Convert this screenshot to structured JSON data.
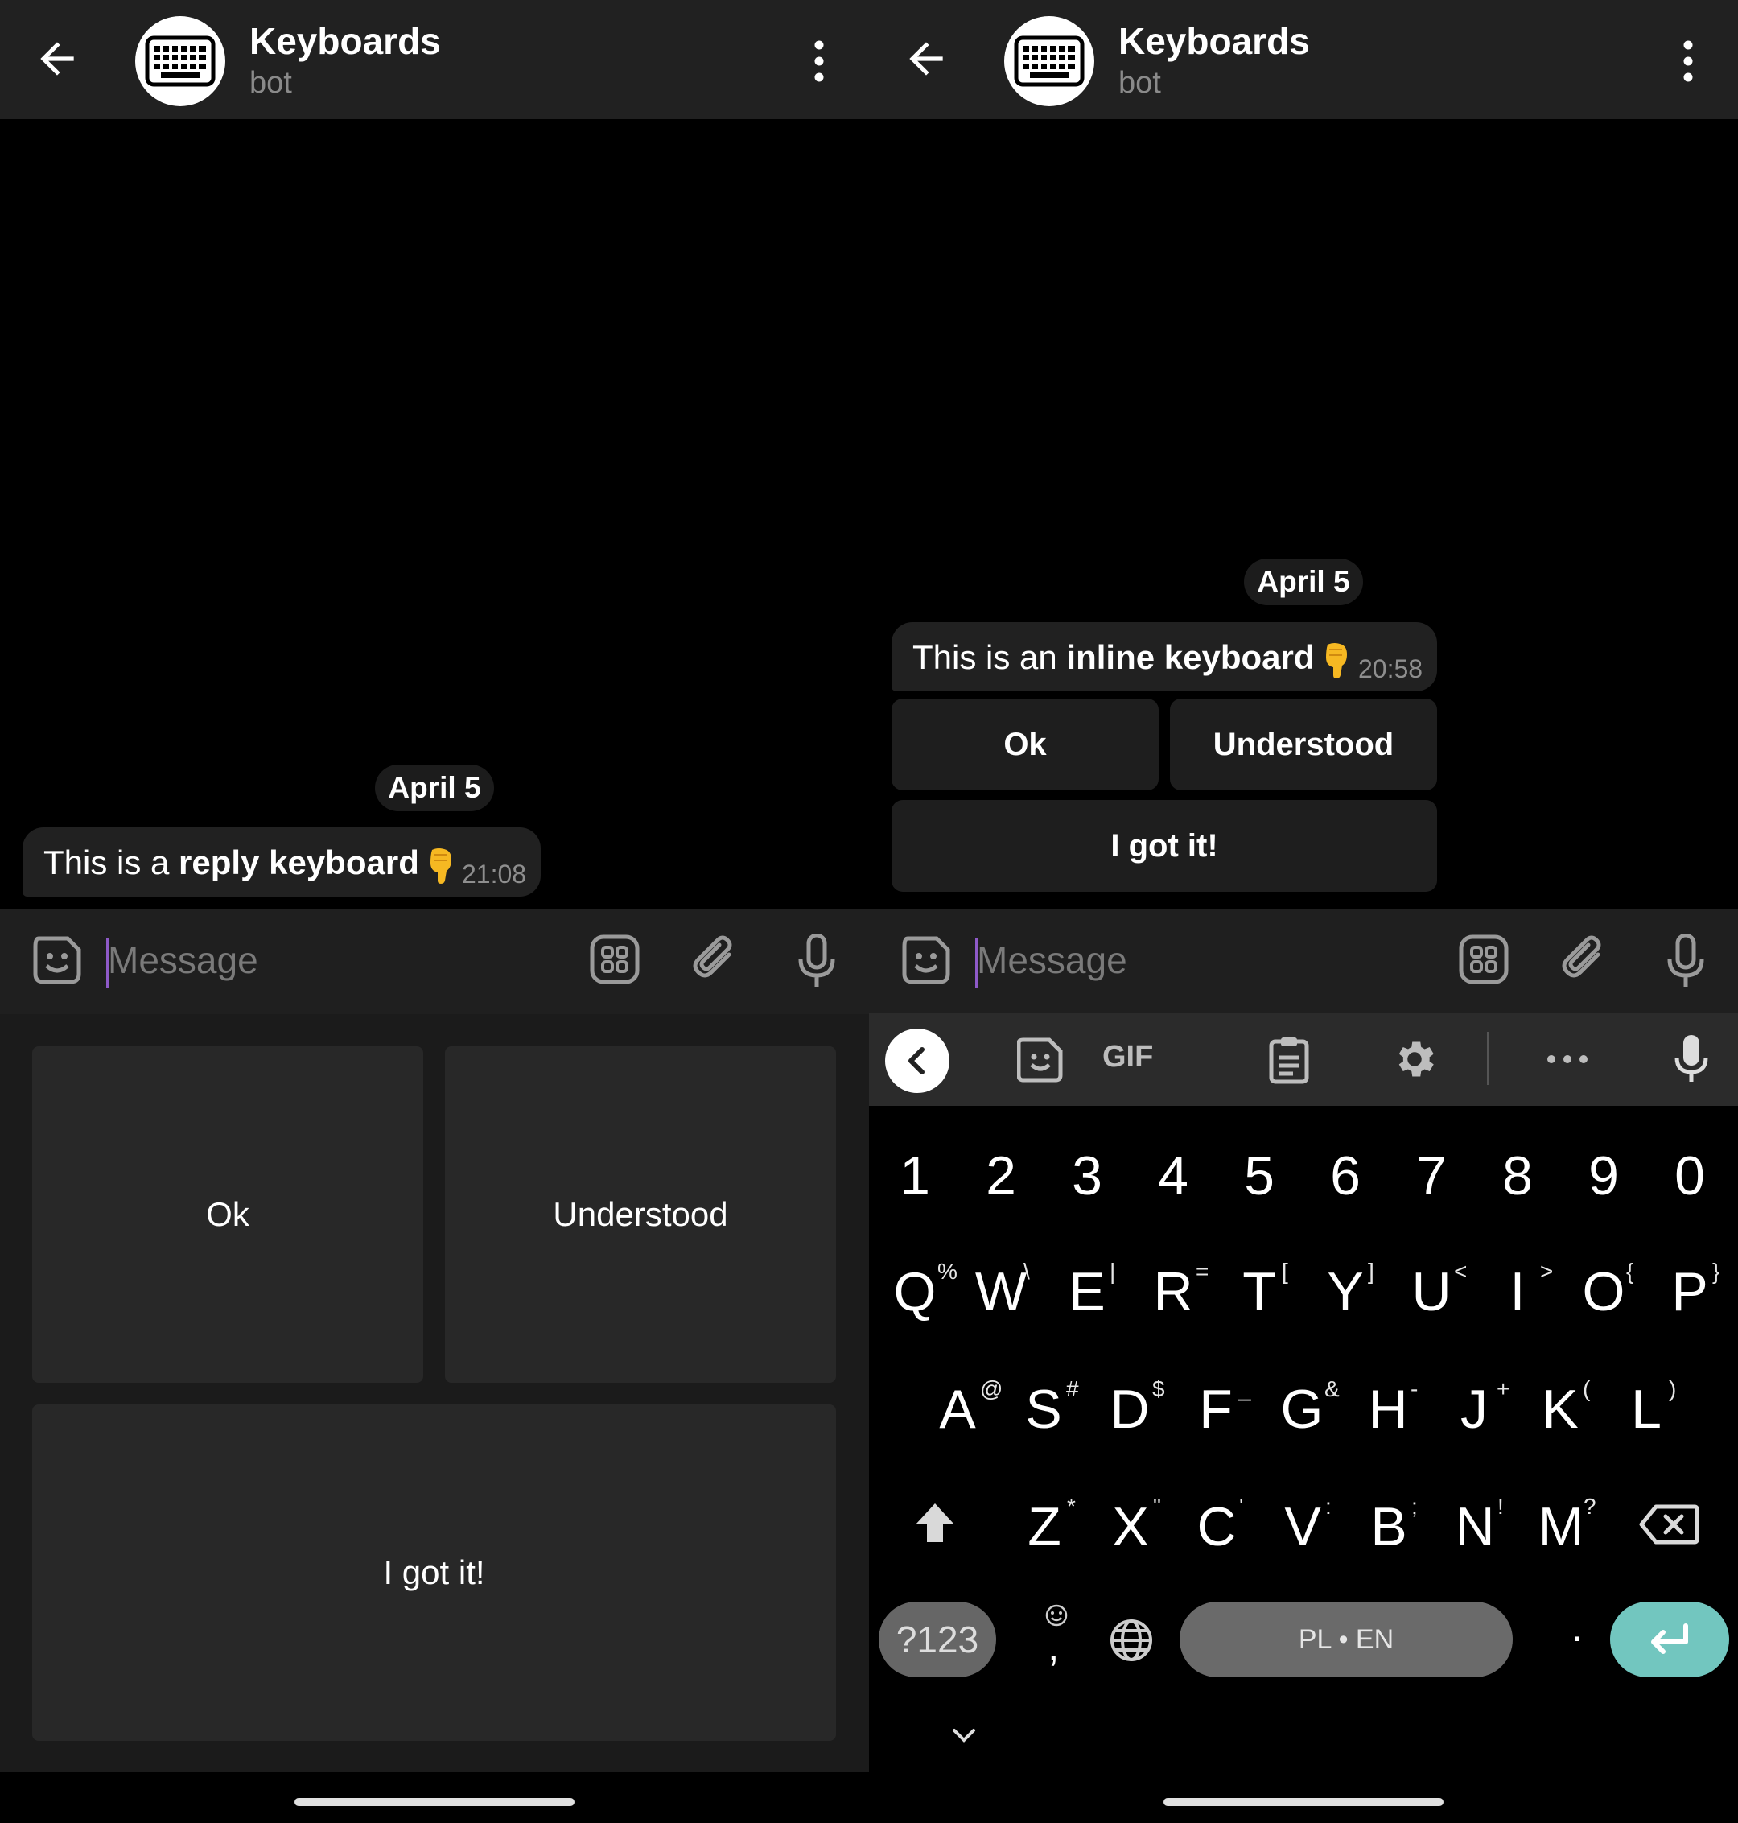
{
  "chat": {
    "title": "Keyboards",
    "subtitle": "bot",
    "date": "April 5",
    "input_placeholder": "Message"
  },
  "left": {
    "message": {
      "prefix": "This is a ",
      "bold": "reply keyboard",
      "time": "21:08"
    },
    "reply_keyboard": [
      "Ok",
      "Understood",
      "I got it!"
    ]
  },
  "right": {
    "message": {
      "prefix": "This is an ",
      "bold": "inline keyboard",
      "time": "20:58"
    },
    "inline_keyboard": [
      "Ok",
      "Understood",
      "I got it!"
    ]
  },
  "gboard": {
    "toolbar": [
      "back-arrow-icon",
      "sticker-icon",
      "GIF",
      "clipboard-icon",
      "settings-gear-icon",
      "more-dots-icon",
      "mic-icon"
    ],
    "gif_label": "GIF",
    "number_row": [
      "1",
      "2",
      "3",
      "4",
      "5",
      "6",
      "7",
      "8",
      "9",
      "0"
    ],
    "row1": [
      [
        "Q",
        "%"
      ],
      [
        "W",
        "\\"
      ],
      [
        "E",
        "|"
      ],
      [
        "R",
        "="
      ],
      [
        "T",
        "["
      ],
      [
        "Y",
        "]"
      ],
      [
        "U",
        "<"
      ],
      [
        "I",
        ">"
      ],
      [
        "O",
        "{"
      ],
      [
        "P",
        "}"
      ]
    ],
    "row2": [
      [
        "A",
        "@"
      ],
      [
        "S",
        "#"
      ],
      [
        "D",
        "$"
      ],
      [
        "F",
        "_"
      ],
      [
        "G",
        "&"
      ],
      [
        "H",
        "-"
      ],
      [
        "J",
        "+"
      ],
      [
        "K",
        "("
      ],
      [
        "L",
        ")"
      ]
    ],
    "row3": [
      [
        "Z",
        "*"
      ],
      [
        "X",
        "\""
      ],
      [
        "C",
        "'"
      ],
      [
        "V",
        ":"
      ],
      [
        "B",
        ";"
      ],
      [
        "N",
        "!"
      ],
      [
        "M",
        "?"
      ]
    ],
    "symbols_key": "?123",
    "comma": ",",
    "space_label": "PL • EN",
    "period": ".",
    "accent_color": "#72c6bf"
  },
  "colors": {
    "header_bg": "#212121",
    "bubble_bg": "#212121",
    "reply_key_bg": "#282828",
    "caret": "#8e5ac8"
  }
}
